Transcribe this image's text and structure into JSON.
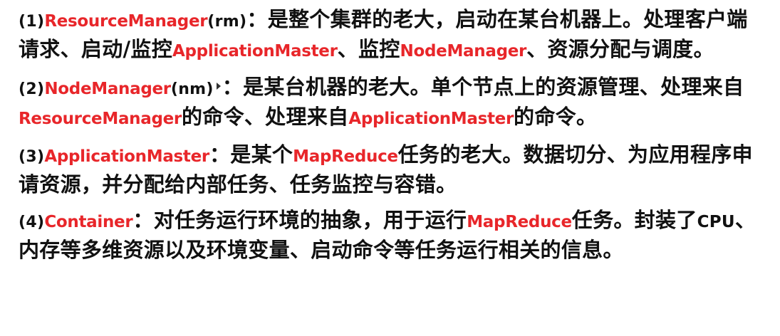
{
  "items": [
    {
      "num": "(1)",
      "term": "ResourceManager",
      "abbr": "(rm)",
      "parts": [
        "：是整个集群的老大，启动在某台机器上。处理客户端请求、启动/监控",
        "ApplicationMaster",
        "、监控",
        "NodeManager",
        "、资源分配与调度。"
      ]
    },
    {
      "num": "(2)",
      "term": "NodeManager",
      "abbr": "(nm)",
      "parts": [
        "：是某台机器的老大。单个节点上的资源管理、处理来自",
        "ResourceManager",
        "的命令、处理来自",
        "ApplicationMaster",
        "的命令。"
      ]
    },
    {
      "num": "(3)",
      "term": "ApplicationMaster",
      "parts": [
        "：是某个",
        "MapReduce",
        "任务的老大。数据切分、为应用程序申请资源，并分配给内部任务、任务监控与容错。"
      ]
    },
    {
      "num": "(4)",
      "term": "Container",
      "parts": [
        "：对任务运行环境的抽象，用于运行",
        "MapReduce",
        "任务。封装了",
        "CPU",
        "、内存等多维资源以及环境变量、启动命令等任务运行相关的信息。"
      ]
    }
  ],
  "colors": {
    "term": "#e8262a",
    "text": "#111111",
    "background": "#ffffff"
  }
}
